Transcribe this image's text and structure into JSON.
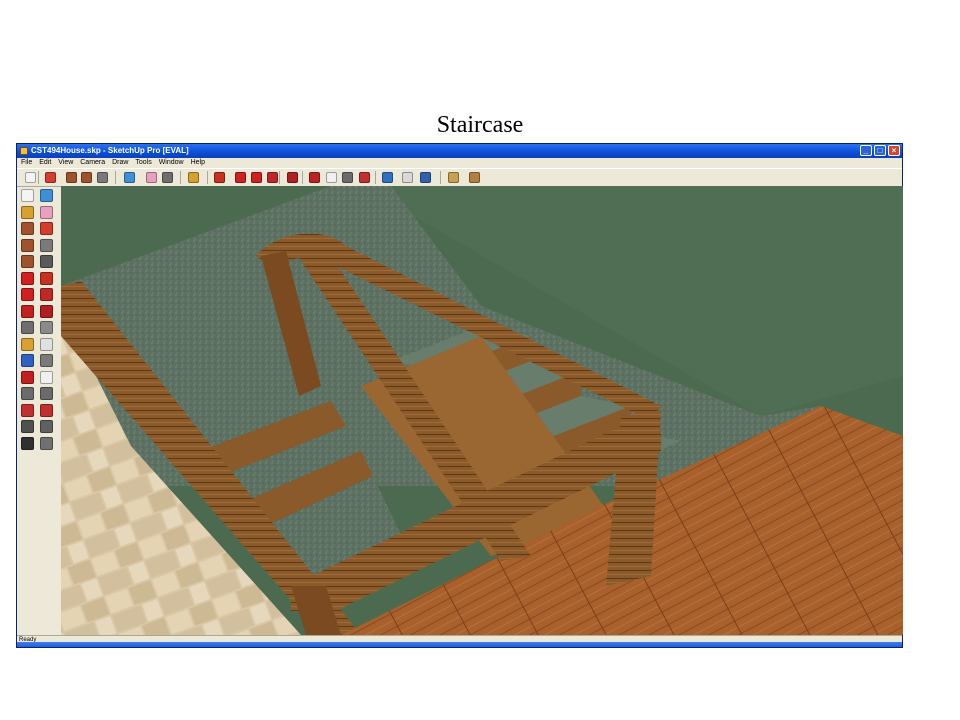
{
  "slide": {
    "title": "Staircase"
  },
  "window": {
    "title": "CST494House.skp - SketchUp Pro [EVAL]",
    "controls": {
      "minimize": "_",
      "maximize": "□",
      "close": "×"
    }
  },
  "menu": {
    "items": [
      "File",
      "Edit",
      "View",
      "Camera",
      "Draw",
      "Tools",
      "Window",
      "Help"
    ]
  },
  "toolbar": {
    "icons": [
      {
        "name": "select-icon",
        "color": "#f4f4f4"
      },
      {
        "name": "pencil-icon",
        "color": "#d43c2c"
      },
      {
        "name": "rectangle-icon",
        "color": "#a0522d"
      },
      {
        "name": "circle-icon",
        "color": "#a0522d"
      },
      {
        "name": "arc-icon",
        "color": "#7a7a7a"
      },
      {
        "name": "make-component-icon",
        "color": "#3f8fd8"
      },
      {
        "name": "eraser-icon",
        "color": "#e8a0c0"
      },
      {
        "name": "tape-measure-icon",
        "color": "#6e6e6e"
      },
      {
        "name": "paint-bucket-icon",
        "color": "#d8a030"
      },
      {
        "name": "push-pull-icon",
        "color": "#c83020"
      },
      {
        "name": "move-icon",
        "color": "#d02020"
      },
      {
        "name": "rotate-icon",
        "color": "#d02020"
      },
      {
        "name": "follow-me-icon",
        "color": "#c02828"
      },
      {
        "name": "offset-icon",
        "color": "#b02020"
      },
      {
        "name": "orbit-icon",
        "color": "#c02020"
      },
      {
        "name": "pan-icon",
        "color": "#f0f0f0"
      },
      {
        "name": "zoom-icon",
        "color": "#6b6b6b"
      },
      {
        "name": "zoom-extents-icon",
        "color": "#c03030"
      },
      {
        "name": "get-models-icon",
        "color": "#3070c0"
      },
      {
        "name": "share-model-icon",
        "color": "#d8d8d8"
      },
      {
        "name": "google-earth-icon",
        "color": "#3060b0"
      },
      {
        "name": "component-warehouse-icon",
        "color": "#c8a050"
      },
      {
        "name": "extension-warehouse-icon",
        "color": "#b08040"
      }
    ]
  },
  "side_toolbar": {
    "icons": [
      "select-icon",
      "make-component-icon",
      "paint-bucket-icon",
      "eraser-icon",
      "rectangle-icon",
      "line-icon",
      "circle-icon",
      "arc-icon",
      "polygon-icon",
      "freehand-icon",
      "move-icon",
      "push-pull-icon",
      "rotate-icon",
      "follow-me-icon",
      "scale-icon",
      "offset-icon",
      "tape-measure-icon",
      "dimension-icon",
      "protractor-icon",
      "text-icon",
      "axes-icon",
      "3d-text-icon",
      "orbit-icon",
      "pan-icon",
      "zoom-icon",
      "zoom-window-icon",
      "zoom-extents-icon",
      "previous-view-icon",
      "position-camera-icon",
      "look-around-icon",
      "walk-icon",
      "section-plane-icon"
    ],
    "colors": {
      "select-icon": "#f4f4f4",
      "make-component-icon": "#3f8fd8",
      "paint-bucket-icon": "#d8a030",
      "eraser-icon": "#e8a0c0",
      "rectangle-icon": "#a0522d",
      "line-icon": "#d43c2c",
      "circle-icon": "#a0522d",
      "arc-icon": "#7a7a7a",
      "polygon-icon": "#a0522d",
      "freehand-icon": "#5a5a5a",
      "move-icon": "#d02020",
      "push-pull-icon": "#c83020",
      "rotate-icon": "#d02020",
      "follow-me-icon": "#c02828",
      "scale-icon": "#c02020",
      "offset-icon": "#b02020",
      "tape-measure-icon": "#6e6e6e",
      "dimension-icon": "#8a8a8a",
      "protractor-icon": "#d8a030",
      "text-icon": "#e0e0e0",
      "axes-icon": "#3060c0",
      "3d-text-icon": "#7a7a7a",
      "orbit-icon": "#c02020",
      "pan-icon": "#f0f0f0",
      "zoom-icon": "#6b6b6b",
      "zoom-window-icon": "#6b6b6b",
      "zoom-extents-icon": "#c03030",
      "previous-view-icon": "#c03030",
      "position-camera-icon": "#505050",
      "look-around-icon": "#606060",
      "walk-icon": "#303030",
      "section-plane-icon": "#707070"
    }
  },
  "status": {
    "text": "Ready"
  },
  "colors": {
    "wall": "#4c6a50",
    "carpet": "#5d7163",
    "wood_floor": "#a8602c",
    "tile": "#d9c7a6",
    "railing": "#8b5a2b"
  }
}
